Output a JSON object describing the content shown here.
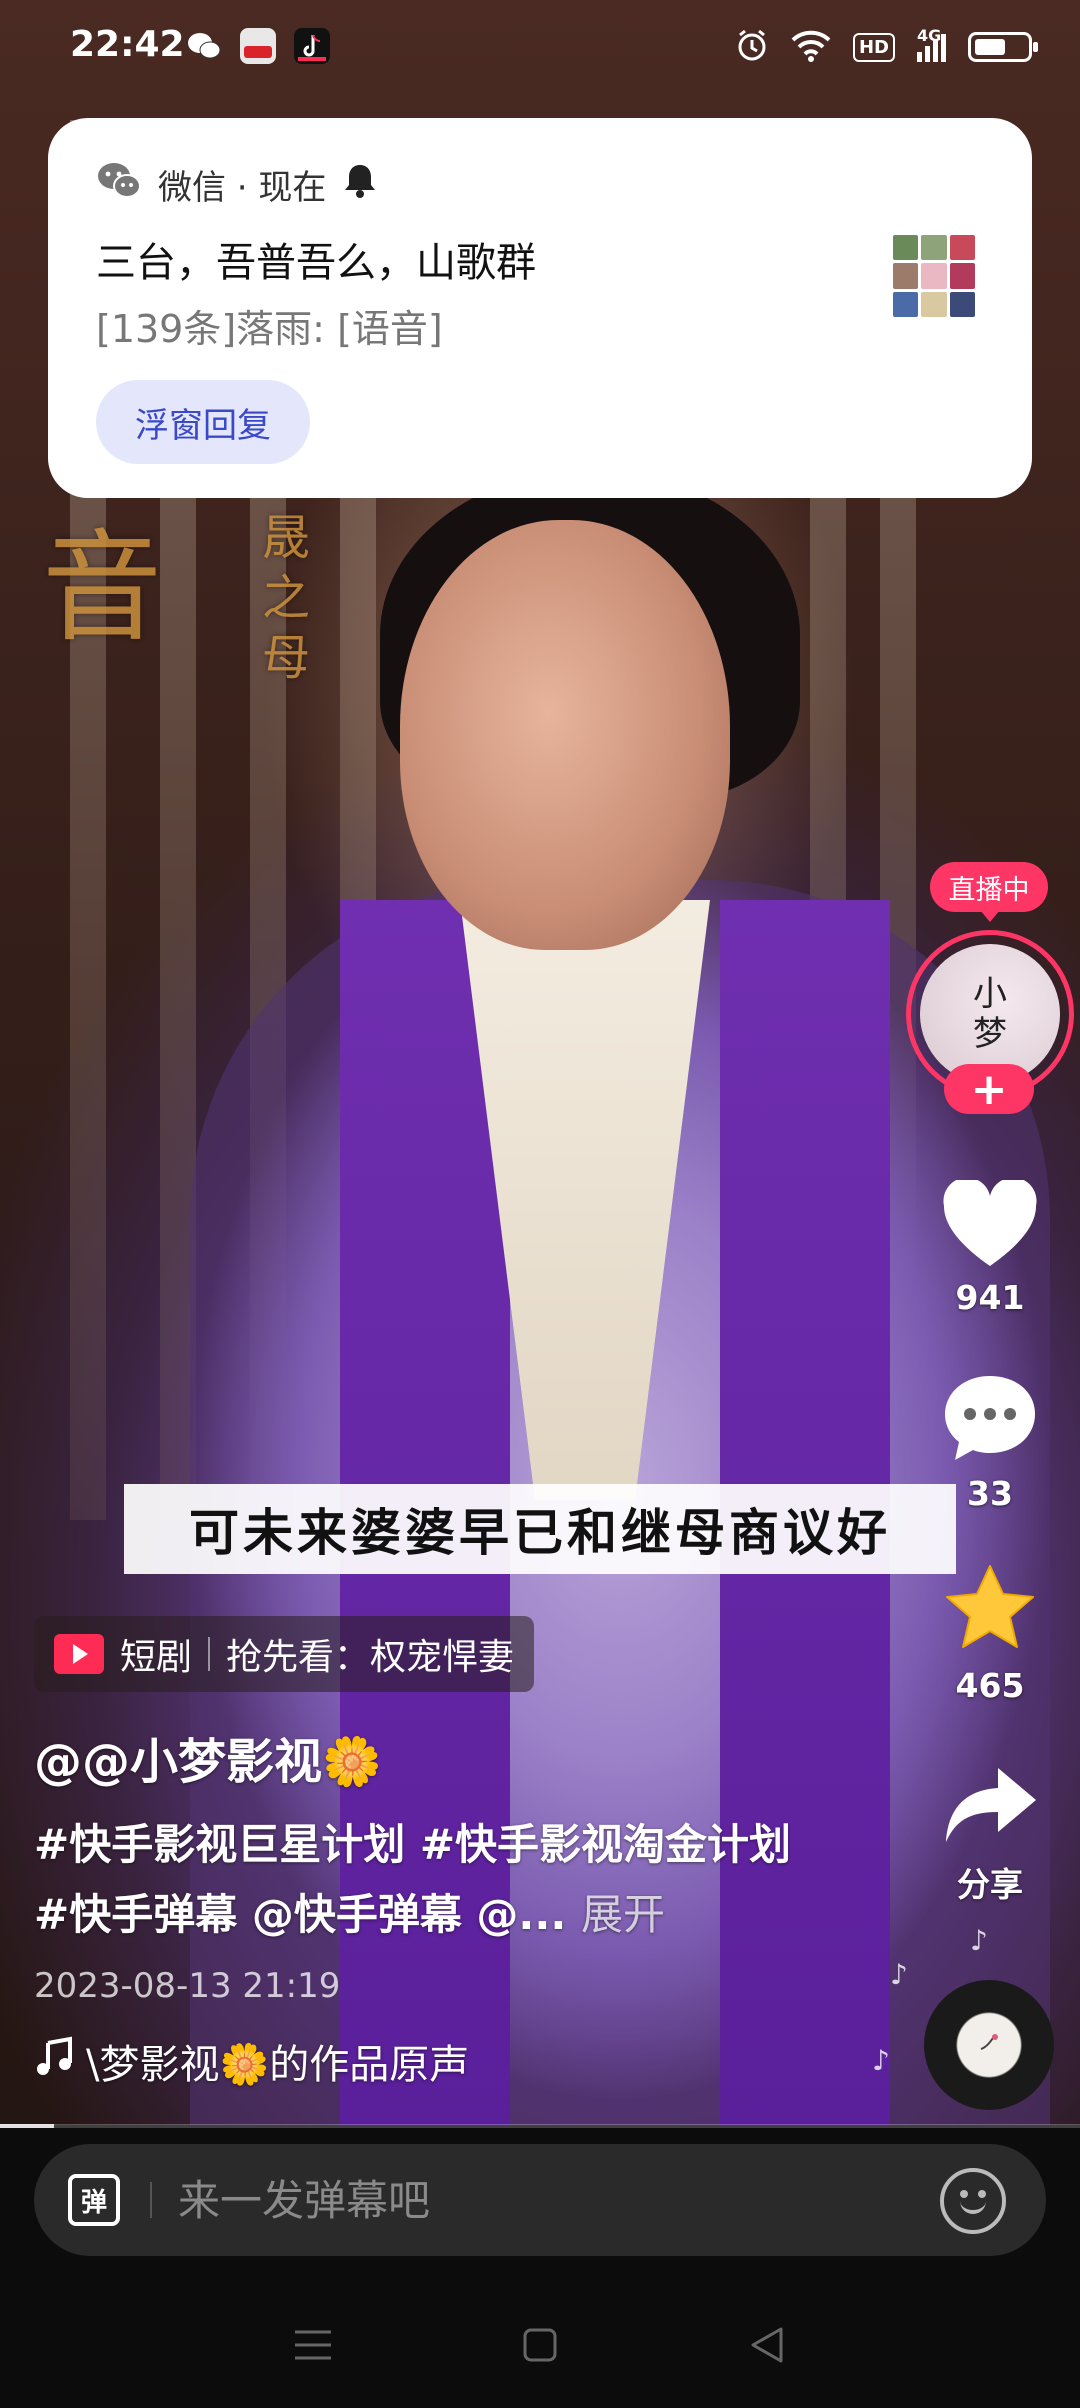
{
  "status_bar": {
    "time": "22:42",
    "left_icons": [
      "wechat-icon",
      "sohu-video-icon",
      "tiktok-icon"
    ],
    "right_icons": [
      "alarm-icon",
      "wifi-icon",
      "hd-icon",
      "signal-4g-icon",
      "battery-icon"
    ],
    "hd_label": "HD",
    "net_label": "4G"
  },
  "notification": {
    "app_name": "微信 · 现在",
    "title": "三台，吾普吾么，山歌群",
    "body": "[139条]落雨: [语音]",
    "action_label": "浮窗回复"
  },
  "video": {
    "poster_chars": [
      "音",
      "晟",
      "之",
      "母"
    ],
    "subtitle": "可未来婆婆早已和继母商议好"
  },
  "side_actions": {
    "live_label": "直播中",
    "avatar_text": "小\n梦",
    "follow_label": "+",
    "like_count": "941",
    "comment_count": "33",
    "favorite_count": "465",
    "share_label": "分享"
  },
  "info": {
    "drama_tag": "短剧",
    "drama_preview": "抢先看：权宠悍妻",
    "author": "@@小梦影视🌼",
    "caption": "#快手影视巨星计划 #快手影视淘金计划 #快手弹幕 @快手弹幕 @...",
    "expand_label": "展开",
    "date": "2023-08-13 21:19",
    "music": "\\梦影视🌼的作品原声"
  },
  "progress": {
    "fraction": 0.05
  },
  "comment_bar": {
    "danmaku_icon_label": "弹",
    "placeholder": "来一发弹幕吧"
  },
  "colors": {
    "accent_red": "#fe3666",
    "notif_button_bg": "#e4e6fb",
    "notif_button_text": "#3a49c8",
    "star_yellow": "#ffc83a"
  }
}
